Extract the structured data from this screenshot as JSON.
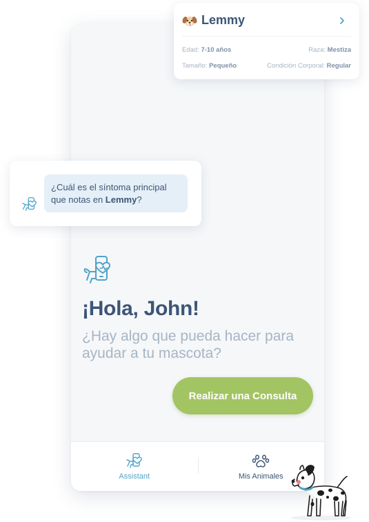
{
  "pet_card": {
    "avatar_icon": "puppy-face-icon",
    "name": "Lemmy",
    "age_label": "Edad:",
    "age_value": "7-10 años",
    "breed_label": "Raza:",
    "breed_value": "Mestiza",
    "size_label": "Tamaño:",
    "size_value": "Pequeño",
    "condition_label": "Condición Corporal:",
    "condition_value": "Regular"
  },
  "chat": {
    "line1": "¿Cuál es el síntoma principal",
    "line2_prefix": "que notas en ",
    "line2_pet": "Lemmy",
    "line2_suffix": "?"
  },
  "welcome": {
    "greeting": "¡Hola, John!",
    "subtitle": "¿Hay algo que pueda hacer para ayudar a tu mascota?"
  },
  "cta": {
    "label": "Realizar una Consulta"
  },
  "bottom_nav": [
    {
      "label": "Assistant",
      "icon": "pet-assistant-icon",
      "active": true
    },
    {
      "label": "Mis Animales",
      "icon": "paw-icon",
      "active": false
    }
  ],
  "colors": {
    "primary_text": "#3d5576",
    "muted_text": "#a7b5c4",
    "accent_blue": "#4fa3c9",
    "cta_green": "#a3c462",
    "bubble_bg": "#e5eff7"
  }
}
